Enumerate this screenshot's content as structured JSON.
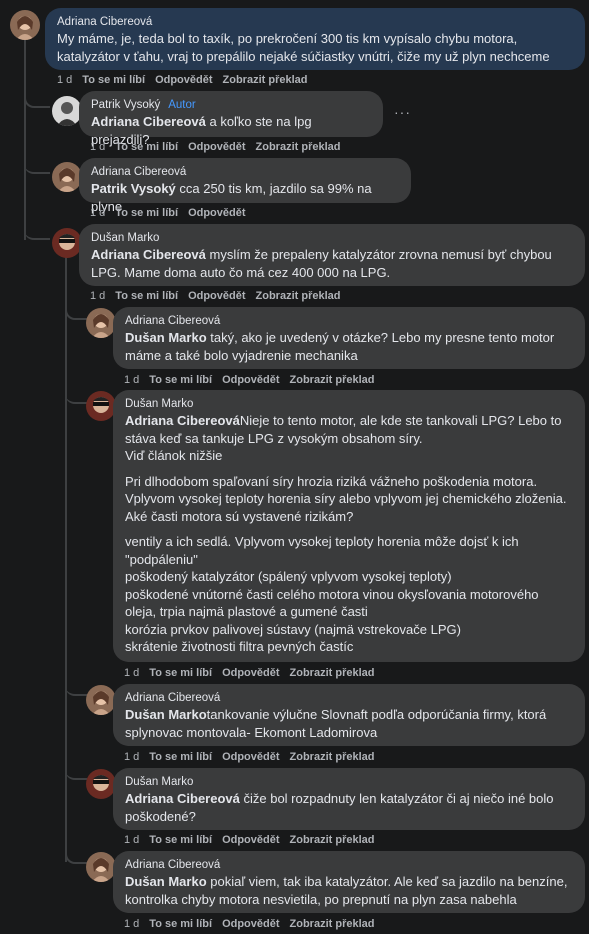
{
  "comments": [
    {
      "author": "Adriana Cibereová",
      "mention": "",
      "text": "My máme, je, teda bol to taxík, po prekročení 300 tis km vypísalo chybu motora, katalyzátor v ťahu, vraj to prepálilo nejaké súčiastky vnútri, čiže my už plyn nechceme",
      "time": "1 d",
      "like": "To se mi líbí",
      "reply": "Odpovědět",
      "translate": "Zobrazit překlad"
    },
    {
      "author": "Patrik Vysoký",
      "badge": "Autor",
      "mention": "Adriana Cibereová",
      "text": " a koľko ste na lpg prejazdili?",
      "more": "···",
      "time": "1 d",
      "like": "To se mi líbí",
      "reply": "Odpovědět",
      "translate": "Zobrazit překlad"
    },
    {
      "author": "Adriana Cibereová",
      "mention": "Patrik Vysoký",
      "text": " cca 250 tis km, jazdilo sa 99% na plyne",
      "time": "1 d",
      "like": "To se mi líbí",
      "reply": "Odpovědět"
    },
    {
      "author": "Dušan Marko",
      "mention": "Adriana Cibereová",
      "text": " myslím že prepaleny katalyzátor zrovna nemusí byť chybou LPG. Mame doma auto čo má cez 400 000 na LPG.",
      "time": "1 d",
      "like": "To se mi líbí",
      "reply": "Odpovědět",
      "translate": "Zobrazit překlad"
    },
    {
      "author": "Adriana Cibereová",
      "mention": "Dušan Marko",
      "text": " taký, ako je uvedený v otázke? Lebo my presne tento motor máme a také bolo vyjadrenie mechanika",
      "time": "1 d",
      "like": "To se mi líbí",
      "reply": "Odpovědět",
      "translate": "Zobrazit překlad"
    },
    {
      "author": "Dušan Marko",
      "mention": "Adriana Cibereová",
      "text": "Nieje to tento motor, ale kde ste tankovali LPG? Lebo to stáva keď sa tankuje LPG z vysokým obsahom síry.",
      "text2": "Viď článok nižšie",
      "para2": "Pri dlhodobom spaľovaní síry hrozia riziká vážneho poškodenia motora. Vplyvom vysokej teploty horenia síry alebo vplyvom jej chemického zloženia. Aké časti motora sú vystavené rizikám?",
      "para3": [
        "ventily a ich sedlá. Vplyvom vysokej teploty horenia môže dojsť k ich \"podpáleniu\"",
        "poškodený katalyzátor (spálený vplyvom vysokej teploty)",
        "poškodené vnútorné časti celého motora vinou okysľovania motorového oleja, trpia najmä plastové a gumené časti",
        "korózia prvkov palivovej sústavy (najmä vstrekovače LPG)",
        "skrátenie životnosti filtra pevných častíc"
      ],
      "time": "1 d",
      "like": "To se mi líbí",
      "reply": "Odpovědět",
      "translate": "Zobrazit překlad"
    },
    {
      "author": "Adriana Cibereová",
      "mention": "Dušan Marko",
      "text": "tankovanie výlučne Slovnaft podľa odporúčania firmy, ktorá splynovac montovala- Ekomont Ladomirova",
      "time": "1 d",
      "like": "To se mi líbí",
      "reply": "Odpovědět",
      "translate": "Zobrazit překlad"
    },
    {
      "author": "Dušan Marko",
      "mention": "Adriana Cibereová",
      "text": " čiže bol rozpadnuty len katalyzátor či aj niečo iné bolo poškodené?",
      "time": "1 d",
      "like": "To se mi líbí",
      "reply": "Odpovědět",
      "translate": "Zobrazit překlad"
    },
    {
      "author": "Adriana Cibereová",
      "mention": "Dušan Marko",
      "text": " pokiaľ viem, tak iba katalyzátor. Ale keď sa jazdilo na benzíne, kontrolka chyby motora nesvietila, po prepnutí na plyn zasa nabehla",
      "time": "1 d",
      "like": "To se mi líbí",
      "reply": "Odpovědět",
      "translate": "Zobrazit překlad"
    }
  ],
  "colors": {
    "background": "#18191a",
    "bubble": "#3a3b3c",
    "highlight_bubble": "#263951",
    "secondary_text": "#b0b3b8",
    "author_badge": "#4599ff"
  }
}
